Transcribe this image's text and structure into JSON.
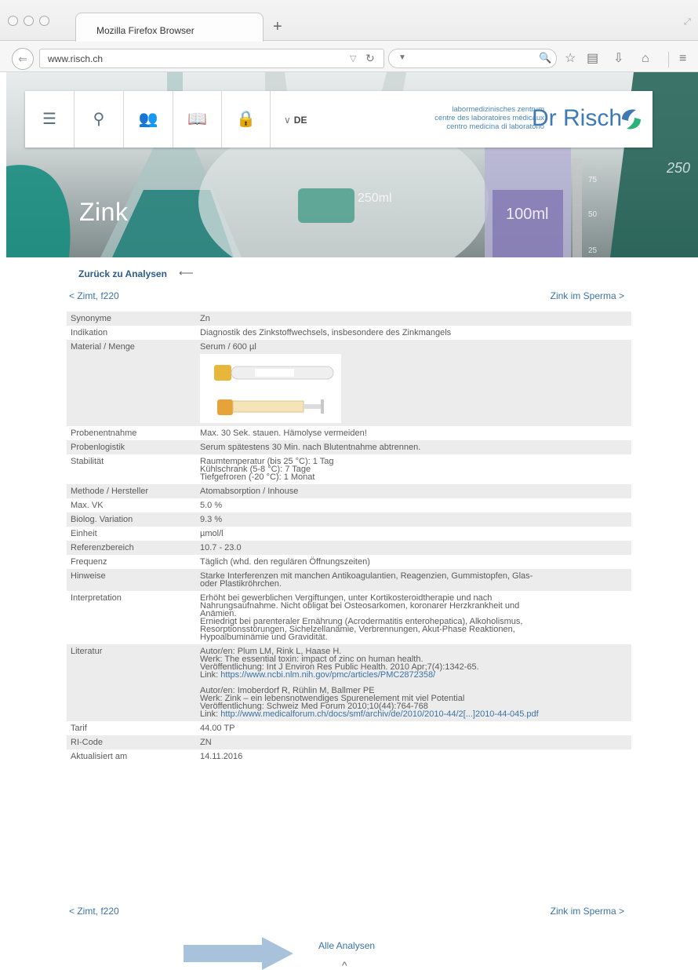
{
  "browser": {
    "tab_title": "Mozilla Firefox Browser",
    "new_tab": "+",
    "url": "www.risch.ch"
  },
  "site": {
    "lang": "DE",
    "tagline": [
      "labormedizinisches zentrum",
      "centre des laboratoires médicaux",
      "centro medicina di laboratorio"
    ],
    "brand": "Dr Risch",
    "colors": {
      "brand_blue": "#3f79b3",
      "brand_green": "#2bb07a",
      "link": "#3a72a6"
    }
  },
  "hero": {
    "title": "Zink",
    "flask_labels": [
      "250ml",
      "100ml",
      "75",
      "50",
      "25",
      "250"
    ]
  },
  "nav": {
    "back": "Zurück zu Analysen",
    "back_arrow": "⟵",
    "prev": "< Zimt, f220",
    "next": "Zink im Sperma >",
    "all": "Alle Analysen",
    "top": "^"
  },
  "rows": [
    {
      "label": "Synonyme",
      "lines": [
        "Zn"
      ]
    },
    {
      "label": "Indikation",
      "lines": [
        "Diagnostik des Zinkstoffwechsels, insbesondere des Zinkmangels"
      ]
    },
    {
      "label": "Material / Menge",
      "lines": [
        "Serum / 600 µl"
      ]
    },
    {
      "label": "Probenentnahme",
      "lines": [
        "Max. 30 Sek. stauen. Hämolyse vermeiden!"
      ]
    },
    {
      "label": "Probenlogistik",
      "lines": [
        "Serum spätestens 30 Min. nach Blutentnahme abtrennen."
      ]
    },
    {
      "label": "Stabilität",
      "lines": [
        "Raumtemperatur (bis 25 °C): 1 Tag",
        "Kühlschrank (5-8 °C): 7 Tage",
        "Tiefgefroren (-20 °C): 1 Monat"
      ]
    },
    {
      "label": "Methode / Hersteller",
      "lines": [
        "Atomabsorption / Inhouse"
      ]
    },
    {
      "label": "Max. VK",
      "lines": [
        "5.0 %"
      ]
    },
    {
      "label": "Biolog. Variation",
      "lines": [
        "9.3 %"
      ]
    },
    {
      "label": "Einheit",
      "lines": [
        "µmol/l"
      ]
    },
    {
      "label": "Referenzbereich",
      "lines": [
        "10.7 - 23.0"
      ]
    },
    {
      "label": "Frequenz",
      "lines": [
        "Täglich (whd. den regulären Öffnungszeiten)"
      ]
    },
    {
      "label": "Hinweise",
      "lines": [
        "Starke Interferenzen mit manchen Antikoagulantien, Reagenzien, Gummistopfen, Glas-",
        "oder Plastikröhrchen."
      ]
    },
    {
      "label": "Interpretation",
      "lines": [
        "Erhöht bei gewerblichen Vergiftungen, unter Kortikosteroidtherapie und nach",
        "Nahrungsaufnahme. Nicht obligat bei Osteosarkomen, koronarer Herzkrankheit und",
        "Anämien.",
        "Erniedrigt bei parenteraler Ernährung (Acrodermatitis enterohepatica), Alkoholismus,",
        "Resorptionsstörungen, Sichelzellanämie, Verbrennungen, Akut-Phase Reaktionen,",
        "Hypoalbuminämie und Gravidität."
      ]
    },
    {
      "label": "Literatur",
      "lines": []
    },
    {
      "label": "Tarif",
      "lines": [
        "44.00 TP"
      ]
    },
    {
      "label": "RI-Code",
      "lines": [
        "ZN"
      ]
    },
    {
      "label": "Aktualisiert am",
      "lines": [
        "14.11.2016"
      ]
    }
  ],
  "literature": [
    {
      "authors": "Autor/en: Plum LM, Rink L, Haase H.",
      "work": "Werk: The essential toxin: impact of zinc on human health.",
      "pub": "Veröffentlichung: Int J Environ Res Public Health. 2010 Apr;7(4):1342-65.",
      "link_prefix": "Link: ",
      "link": "https://www.ncbi.nlm.nih.gov/pmc/articles/PMC2872358/"
    },
    {
      "authors": "Autor/en: Imoberdorf R, Rühlin M, Ballmer PE",
      "work": "Werk: Zink – ein lebensnotwendiges Spurenelement mit viel Potential",
      "pub": "Veröffentlichung: Schweiz Med Forum 2010;10(44):764-768",
      "link_prefix": "Link: ",
      "link": "http://www.medicalforum.ch/docs/smf/archiv/de/2010/2010-44/2[...]2010-44-045.pdf"
    }
  ]
}
